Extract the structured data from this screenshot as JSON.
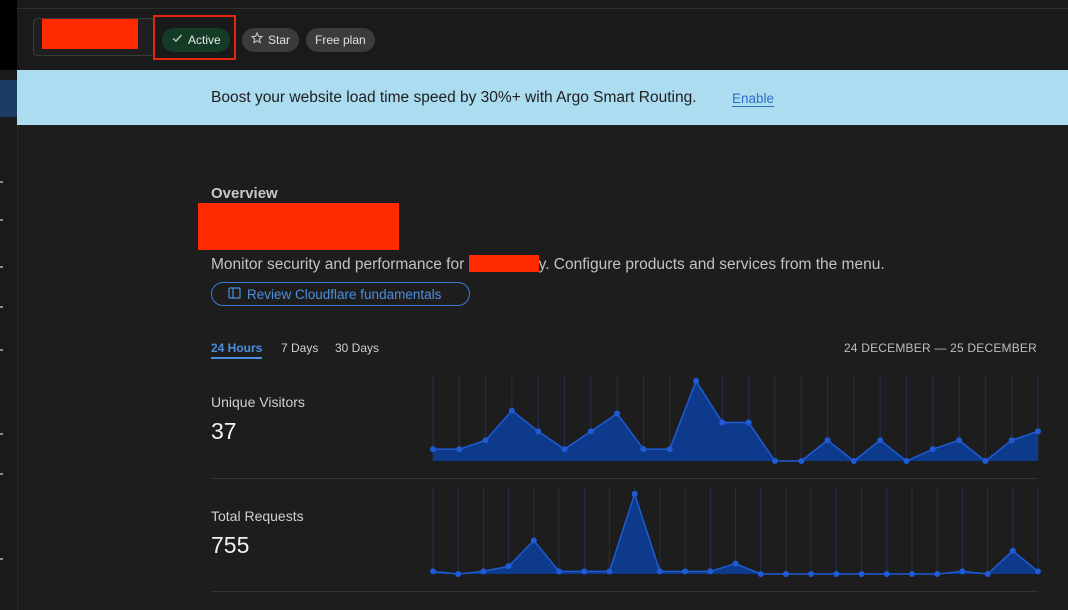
{
  "header": {
    "status_label": "Active",
    "star_label": "Star",
    "plan_label": "Free plan"
  },
  "banner": {
    "text": "Boost your website load time speed by 30%+ with Argo Smart Routing.",
    "link": "Enable"
  },
  "overview": {
    "label": "Overview",
    "description_prefix": "Monitor security and performance for",
    "description_suffix": "y. Configure products and services from the menu.",
    "fundamentals_button": "Review Cloudflare fundamentals"
  },
  "time_tabs": [
    "24 Hours",
    "7 Days",
    "30 Days"
  ],
  "selected_tab": "24 Hours",
  "date_range": "24 DECEMBER — 25 DECEMBER",
  "metrics": [
    {
      "label": "Unique Visitors",
      "value": "37"
    },
    {
      "label": "Total Requests",
      "value": "755"
    }
  ],
  "colors": {
    "accent": "#4a8fe0",
    "chart_fill": "#0d3a8a",
    "chart_line": "#1f5bd6",
    "banner_bg": "#abdcf0",
    "active_badge": "#133b26",
    "redaction": "#ff2a00"
  },
  "chart_data": [
    {
      "type": "area",
      "series": [
        {
          "values": [
            4,
            4,
            7,
            17,
            10,
            4,
            10,
            16,
            4,
            4,
            27,
            13,
            13,
            0,
            0,
            7,
            0,
            7,
            0,
            4,
            7,
            0,
            7,
            10
          ]
        }
      ]
    },
    {
      "type": "area",
      "series": [
        {
          "values": [
            1,
            0,
            1,
            3,
            13,
            1,
            1,
            1,
            31,
            1,
            1,
            1,
            4,
            0,
            0,
            0,
            0,
            0,
            0,
            0,
            0,
            1,
            0,
            9,
            1
          ]
        }
      ]
    }
  ]
}
